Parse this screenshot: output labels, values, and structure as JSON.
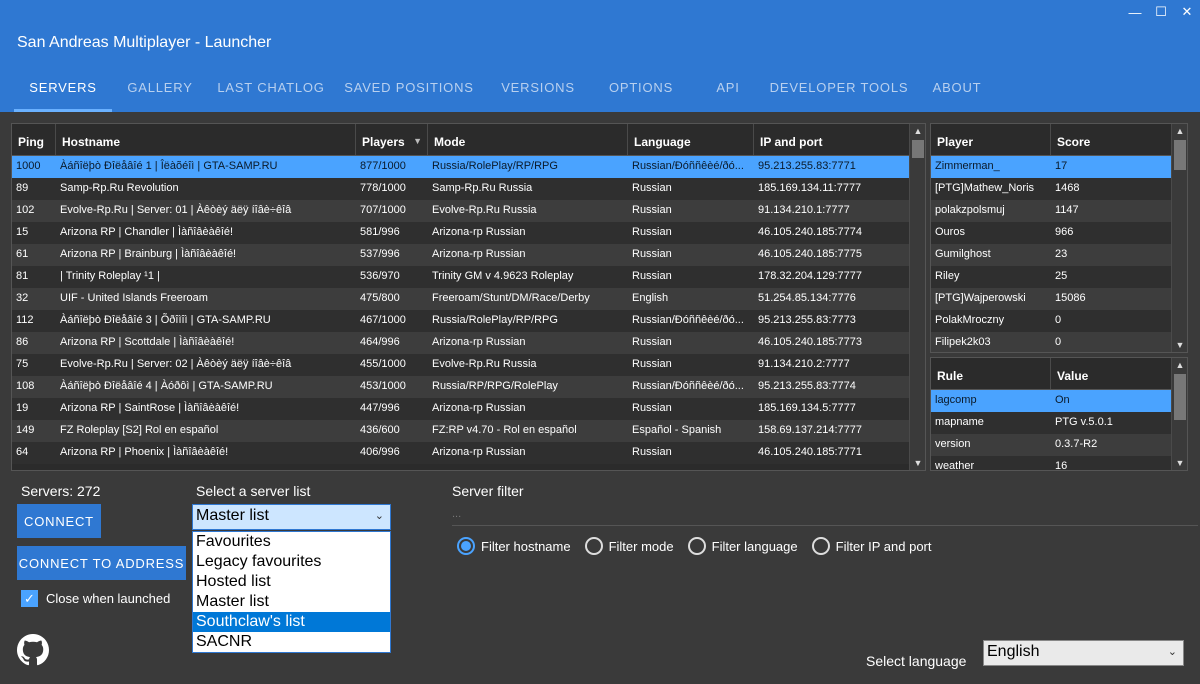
{
  "window": {
    "title": "San Andreas Multiplayer - Launcher",
    "controls": [
      "—",
      "☐",
      "✕"
    ]
  },
  "tabs": [
    "SERVERS",
    "GALLERY",
    "LAST CHATLOG",
    "SAVED POSITIONS",
    "VERSIONS",
    "OPTIONS",
    "API",
    "DEVELOPER TOOLS",
    "ABOUT"
  ],
  "servers": {
    "columns": [
      "Ping",
      "Hostname",
      "Players",
      "Mode",
      "Language",
      "IP and port"
    ],
    "rows": [
      [
        "1000",
        "Àáñîëþò Ðîëåâîé 1 | Îëàõéîì | GTA-SAMP.RU",
        "877/1000",
        "Russia/RolePlay/RP/RPG",
        "Russian/Ðóññêèé/ðó...",
        "95.213.255.83:7771"
      ],
      [
        "89",
        "Samp-Rp.Ru Revolution",
        "778/1000",
        "Samp-Rp.Ru Russia",
        "Russian",
        "185.169.134.11:7777"
      ],
      [
        "102",
        "Evolve-Rp.Ru | Server: 01 | Àêòèý äëÿ íîâè÷êîâ",
        "707/1000",
        "Evolve-Rp.Ru Russia",
        "Russian",
        "91.134.210.1:7777"
      ],
      [
        "15",
        "Arizona RP | Chandler | Ìàñîâèàêîé!",
        "581/996",
        "Arizona-rp Russian",
        "Russian",
        "46.105.240.185:7774"
      ],
      [
        "61",
        "Arizona RP | Brainburg | Ìàñîâèàêîé!",
        "537/996",
        "Arizona-rp Russian",
        "Russian",
        "46.105.240.185:7775"
      ],
      [
        "81",
        "|       Trinity Roleplay  ¹1      |",
        "536/970",
        "Trinity GM v 4.9623 Roleplay",
        "Russian",
        "178.32.204.129:7777"
      ],
      [
        "32",
        "UIF - United Islands Freeroam",
        "475/800",
        "Freeroam/Stunt/DM/Race/Derby",
        "English",
        "51.254.85.134:7776"
      ],
      [
        "112",
        "Àáñîëþò Ðîëåâîé 3 | Õðîìîì | GTA-SAMP.RU",
        "467/1000",
        "Russia/RolePlay/RP/RPG",
        "Russian/Ðóññêèé/ðó...",
        "95.213.255.83:7773"
      ],
      [
        "86",
        "Arizona RP | Scottdale | Ìàñîâèàêîé!",
        "464/996",
        "Arizona-rp Russian",
        "Russian",
        "46.105.240.185:7773"
      ],
      [
        "75",
        "Evolve-Rp.Ru | Server: 02 | Àêòèý äëÿ íîâè÷êîâ",
        "455/1000",
        "Evolve-Rp.Ru Russia",
        "Russian",
        "91.134.210.2:7777"
      ],
      [
        "108",
        "Àáñîëþò Ðîëåâîé 4 | Àóðôì | GTA-SAMP.RU",
        "453/1000",
        "Russia/RP/RPG/RolePlay",
        "Russian/Ðóññêèé/ðó...",
        "95.213.255.83:7774"
      ],
      [
        "19",
        "Arizona RP | SaintRose | Ìàñîâèàêîé!",
        "447/996",
        "Arizona-rp Russian",
        "Russian",
        "185.169.134.5:7777"
      ],
      [
        "149",
        "FZ Roleplay [S2] Rol en español",
        "436/600",
        "FZ:RP v4.70 - Rol en español",
        "Español - Spanish",
        "158.69.137.214:7777"
      ],
      [
        "64",
        "Arizona RP | Phoenix | Ìàñîâèàêîé!",
        "406/996",
        "Arizona-rp Russian",
        "Russian",
        "46.105.240.185:7771"
      ]
    ]
  },
  "players": {
    "columns": [
      "Player",
      "Score"
    ],
    "rows": [
      [
        "Zimmerman_",
        "17"
      ],
      [
        "[PTG]Mathew_Noris",
        "1468"
      ],
      [
        "polakzpolsmuj",
        "1147"
      ],
      [
        "Ouros",
        "966"
      ],
      [
        "Gumilghost",
        "23"
      ],
      [
        "Riley",
        "25"
      ],
      [
        "[PTG]Wajperowski",
        "15086"
      ],
      [
        "PolakMroczny",
        "0"
      ],
      [
        "Filipek2k03",
        "0"
      ]
    ]
  },
  "rules": {
    "columns": [
      "Rule",
      "Value"
    ],
    "rows": [
      [
        "lagcomp",
        "On"
      ],
      [
        "mapname",
        "PTG v.5.0.1"
      ],
      [
        "version",
        "0.3.7-R2"
      ],
      [
        "weather",
        "16"
      ]
    ]
  },
  "bottom": {
    "servers_count": "Servers: 272",
    "connect": "CONNECT",
    "connect_address": "CONNECT TO ADDRESS",
    "close_when_launched": "Close when launched",
    "select_list_label": "Select a server list",
    "selected_list": "Master list",
    "list_options": [
      "Favourites",
      "Legacy favourites",
      "Hosted list",
      "Master list",
      "Southclaw's list",
      "SACNR"
    ],
    "server_filter_label": "Server filter",
    "filter_placeholder": "...",
    "filters": [
      "Filter hostname",
      "Filter mode",
      "Filter language",
      "Filter IP and port"
    ],
    "select_language_label": "Select language",
    "language": "English"
  },
  "colors": {
    "accent": "#2f78d2",
    "selection": "#4aa3ff",
    "background": "#3a3a3a"
  }
}
